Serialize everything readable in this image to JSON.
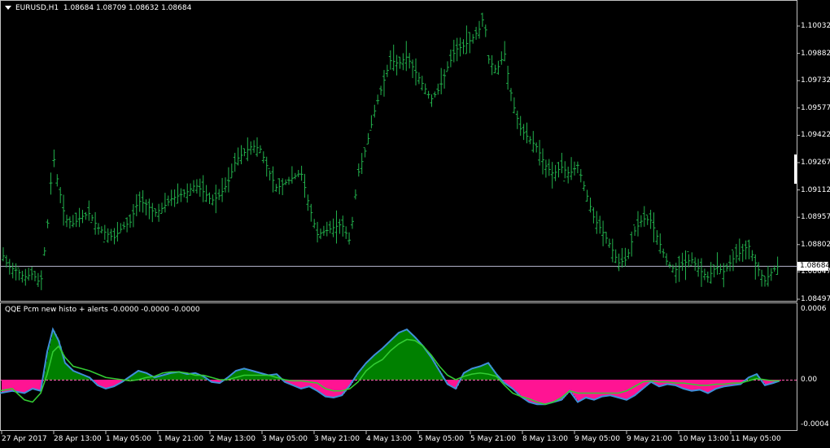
{
  "main_title": {
    "symbol": "EURUSD,H1",
    "ohlc": "1.08684 1.08709 1.08632 1.08684"
  },
  "price_box": "1.08684",
  "price_axis": [
    "1.10032",
    "1.09882",
    "1.09732",
    "1.09577",
    "1.09422",
    "1.09267",
    "1.09112",
    "1.08957",
    "1.08802",
    "1.08647",
    "1.08497"
  ],
  "sub_title": "QQE Pcm new histo + alerts -0.0000 -0.0000 -0.0000",
  "sub_axis": [
    "0.0006",
    "0.00",
    "-0.0004"
  ],
  "time_axis": [
    "27 Apr 2017",
    "28 Apr 13:00",
    "1 May 05:00",
    "1 May 21:00",
    "2 May 13:00",
    "3 May 05:00",
    "3 May 21:00",
    "4 May 13:00",
    "5 May 05:00",
    "5 May 21:00",
    "8 May 13:00",
    "9 May 05:00",
    "9 May 21:00",
    "10 May 13:00",
    "11 May 05:00"
  ],
  "colors": {
    "bars": "#22b14c",
    "histo_up": "#008000",
    "histo_down": "#ff1493",
    "qqe_line": "#3f8fd8",
    "signal_line": "#33cc33",
    "grid": "#c0c0c0",
    "zero_line": "#ff69b4"
  },
  "chart_data": [
    {
      "type": "line",
      "title": "EURUSD,H1",
      "ylim": [
        1.0845,
        1.1018
      ],
      "ticks": [
        "1.10032",
        "1.09882",
        "1.09732",
        "1.09577",
        "1.09422",
        "1.09267",
        "1.09112",
        "1.08957",
        "1.08802",
        "1.08647",
        "1.08497"
      ],
      "x": [
        0,
        10,
        20,
        30,
        40,
        50,
        60,
        65,
        70,
        80,
        90,
        100,
        110,
        120,
        130,
        140,
        150,
        160,
        170,
        180,
        190,
        200,
        210,
        220,
        230,
        240,
        250,
        260,
        270,
        280,
        290,
        300,
        310,
        320,
        330,
        340,
        350,
        360,
        370,
        380,
        390,
        400,
        410,
        420,
        430,
        440,
        450,
        460,
        470,
        480,
        490,
        500,
        510,
        520,
        530,
        540,
        550,
        560,
        570,
        580,
        590,
        595,
        600,
        610,
        620,
        630,
        640,
        650,
        660,
        670,
        680,
        690,
        700,
        710,
        720,
        730,
        740,
        750,
        760,
        770,
        780,
        790,
        800,
        810,
        820,
        830,
        840,
        850,
        860,
        870,
        880,
        890,
        900,
        910,
        920,
        930,
        940,
        950,
        955
      ],
      "values": [
        1.0878,
        1.0868,
        1.0866,
        1.0862,
        1.0864,
        1.0858,
        1.0898,
        1.0932,
        1.0918,
        1.0895,
        1.0892,
        1.0896,
        1.0898,
        1.089,
        1.0887,
        1.0884,
        1.089,
        1.0893,
        1.0905,
        1.0903,
        1.0898,
        1.0901,
        1.0906,
        1.0908,
        1.091,
        1.0914,
        1.091,
        1.0905,
        1.0908,
        1.0915,
        1.0928,
        1.0932,
        1.0936,
        1.0934,
        1.0922,
        1.0912,
        1.0915,
        1.0918,
        1.0921,
        1.0902,
        1.0886,
        1.0888,
        1.089,
        1.0892,
        1.0882,
        1.092,
        1.0935,
        1.0955,
        1.097,
        1.0984,
        1.0982,
        1.0986,
        1.0978,
        1.097,
        1.0962,
        1.0968,
        1.098,
        1.099,
        1.0992,
        1.0996,
        1.1002,
        1.101,
        1.0985,
        1.0978,
        1.0988,
        1.096,
        1.0945,
        1.094,
        1.0935,
        1.0925,
        1.092,
        1.0924,
        1.092,
        1.0925,
        1.091,
        1.0895,
        1.0888,
        1.088,
        1.087,
        1.0872,
        1.0888,
        1.0895,
        1.0894,
        1.0882,
        1.087,
        1.0866,
        1.087,
        1.0872,
        1.0866,
        1.0862,
        1.0868,
        1.0865,
        1.0872,
        1.0876,
        1.088,
        1.0868,
        1.086,
        1.0866,
        1.0868
      ]
    },
    {
      "type": "area",
      "title": "QQE Pcm new histo + alerts -0.0000 -0.0000 -0.0000",
      "ylim": [
        -0.00055,
        0.00075
      ],
      "ticks": [
        "0.0006",
        "0.00",
        "-0.0004"
      ],
      "x": [
        0,
        15,
        30,
        40,
        50,
        58,
        65,
        72,
        80,
        90,
        100,
        110,
        120,
        130,
        140,
        150,
        160,
        170,
        180,
        190,
        200,
        210,
        220,
        230,
        240,
        250,
        260,
        270,
        280,
        290,
        300,
        310,
        320,
        330,
        340,
        350,
        360,
        370,
        380,
        390,
        400,
        410,
        420,
        430,
        440,
        450,
        460,
        470,
        480,
        490,
        500,
        510,
        520,
        530,
        540,
        550,
        560,
        570,
        580,
        590,
        600,
        610,
        620,
        630,
        640,
        650,
        660,
        670,
        680,
        690,
        700,
        710,
        720,
        730,
        740,
        750,
        760,
        770,
        780,
        790,
        800,
        810,
        820,
        830,
        840,
        850,
        860,
        870,
        880,
        890,
        900,
        910,
        920,
        930,
        940,
        950,
        958
      ],
      "histogram": [
        -0.00012,
        -0.0001,
        -0.00012,
        -8e-05,
        -0.0001,
        0.00025,
        0.00045,
        0.00035,
        0.00015,
        8e-05,
        5e-05,
        2e-05,
        -5e-05,
        -8e-05,
        -6e-05,
        -2e-05,
        3e-05,
        8e-05,
        6e-05,
        2e-05,
        4e-05,
        6e-05,
        7e-05,
        5e-05,
        6e-05,
        3e-05,
        -2e-05,
        -3e-05,
        2e-05,
        8e-05,
        0.0001,
        8e-05,
        6e-05,
        4e-05,
        5e-05,
        -2e-05,
        -5e-05,
        -8e-05,
        -6e-05,
        -0.0001,
        -0.00015,
        -0.00016,
        -0.00014,
        -5e-05,
        6e-05,
        0.00015,
        0.00022,
        0.00028,
        0.00035,
        0.00042,
        0.00045,
        0.00038,
        0.0003,
        0.0002,
        8e-05,
        -4e-05,
        -8e-05,
        6e-05,
        0.0001,
        0.00012,
        0.00015,
        5e-05,
        -3e-05,
        -8e-05,
        -0.00015,
        -0.0002,
        -0.00022,
        -0.00022,
        -0.0002,
        -0.00018,
        -0.0001,
        -0.0002,
        -0.00016,
        -0.00018,
        -0.00015,
        -0.00014,
        -0.00016,
        -0.00018,
        -0.00014,
        -8e-05,
        -2e-05,
        -6e-05,
        -4e-05,
        -5e-05,
        -8e-05,
        -0.0001,
        -9e-05,
        -0.00012,
        -8e-05,
        -6e-05,
        -5e-05,
        -4e-05,
        2e-05,
        5e-05,
        -5e-05,
        -3e-05,
        -1e-05
      ],
      "signal": [
        -0.0001,
        -8e-05,
        -0.00018,
        -0.0002,
        -0.00012,
        5e-05,
        0.00025,
        0.0003,
        0.0002,
        0.00012,
        0.0001,
        8e-05,
        5e-05,
        2e-05,
        1e-05,
        0.0,
        -1e-05,
        0.0,
        2e-05,
        3e-05,
        6e-05,
        7e-05,
        7e-05,
        6e-05,
        4e-05,
        4e-05,
        2e-05,
        0.0,
        0.0,
        2e-05,
        4e-05,
        4e-05,
        4e-05,
        4e-05,
        2e-05,
        0.0,
        -1e-05,
        -1e-05,
        -2e-05,
        -3e-05,
        -8e-05,
        -0.0001,
        -0.0001,
        -8e-05,
        -2e-05,
        8e-05,
        0.00014,
        0.00018,
        0.00026,
        0.00032,
        0.00036,
        0.00035,
        0.0003,
        0.00022,
        0.00012,
        4e-05,
        0.0,
        3e-05,
        5e-05,
        6e-05,
        5e-05,
        3e-05,
        -5e-05,
        -0.00012,
        -0.00015,
        -0.00017,
        -0.0002,
        -0.00022,
        -0.0002,
        -0.00016,
        -0.0001,
        -0.00012,
        -0.00012,
        -0.00012,
        -0.00012,
        -0.00012,
        -0.00012,
        -0.0001,
        -6e-05,
        -2e-05,
        -1e-05,
        -2e-05,
        -2e-05,
        -3e-05,
        -3e-05,
        -4e-05,
        -5e-05,
        -5e-05,
        -4e-05,
        -4e-05,
        -3e-05,
        -3e-05,
        -1e-05,
        1e-05,
        0.0,
        -1e-05,
        -1e-05
      ]
    }
  ]
}
